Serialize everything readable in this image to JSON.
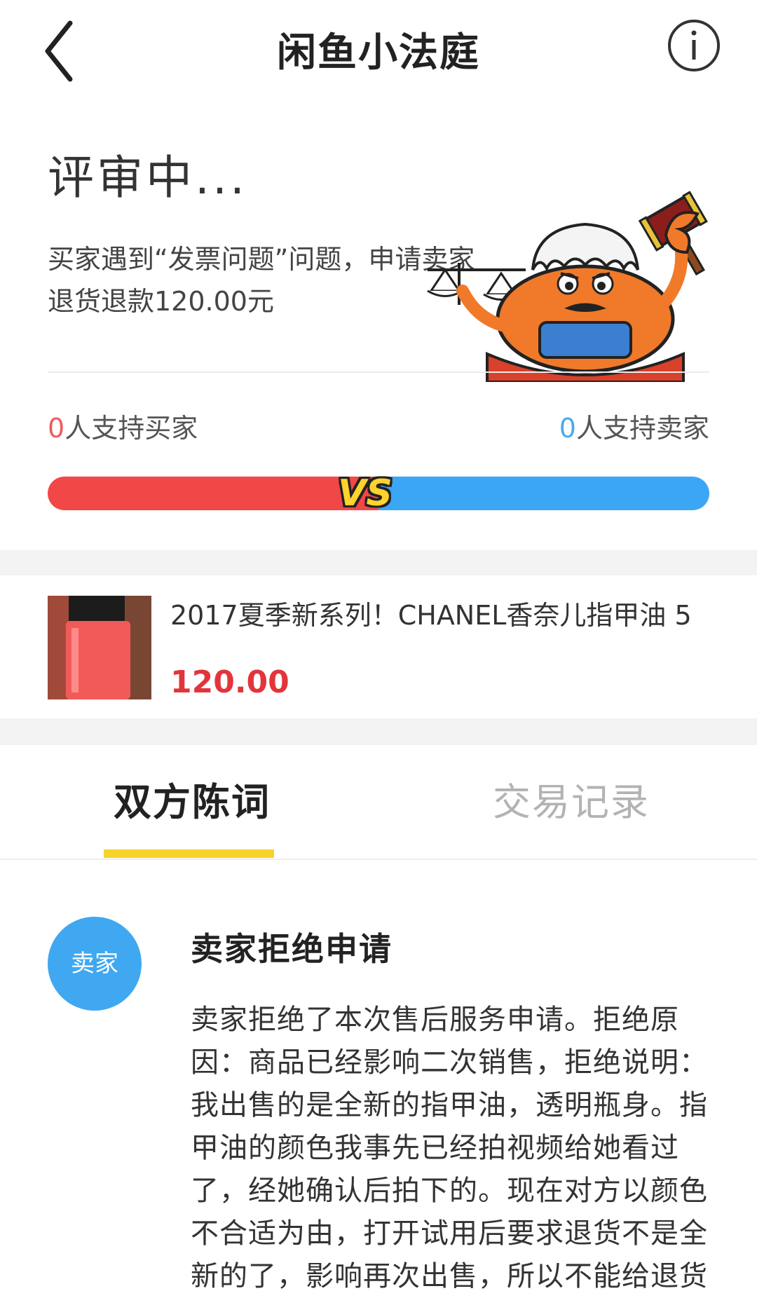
{
  "header": {
    "title": "闲鱼小法庭",
    "back_icon": "chevron-left-icon",
    "info_icon": "info-circle-icon"
  },
  "case": {
    "status": "评审中...",
    "description": "买家遇到“发票问题”问题，申请卖家退货退款120.00元"
  },
  "votes": {
    "buyer_count": "0",
    "buyer_label": "人支持买家",
    "seller_count": "0",
    "seller_label": "人支持卖家",
    "vs_label": "VS",
    "buyer_fraction": 0.5,
    "colors": {
      "buyer": "#f24747",
      "seller": "#3ba6f3"
    }
  },
  "product": {
    "title": "2017夏季新系列！CHANEL香奈儿指甲油 5",
    "price": "120.00"
  },
  "tabs": [
    {
      "label": "双方陈词",
      "active": true
    },
    {
      "label": "交易记录",
      "active": false
    }
  ],
  "statement": {
    "avatar_label": "卖家",
    "title": "卖家拒绝申请",
    "body": "卖家拒绝了本次售后服务申请。拒绝原因：商品已经影响二次销售，拒绝说明：我出售的是全新的指甲油，透明瓶身。指甲油的颜色我事先已经拍视频给她看过了，经她确认后拍下的。现在对方以颜色不合适为由，打开试用后要求退货不是全新的了，影响再次出售，所以不能给退货"
  }
}
